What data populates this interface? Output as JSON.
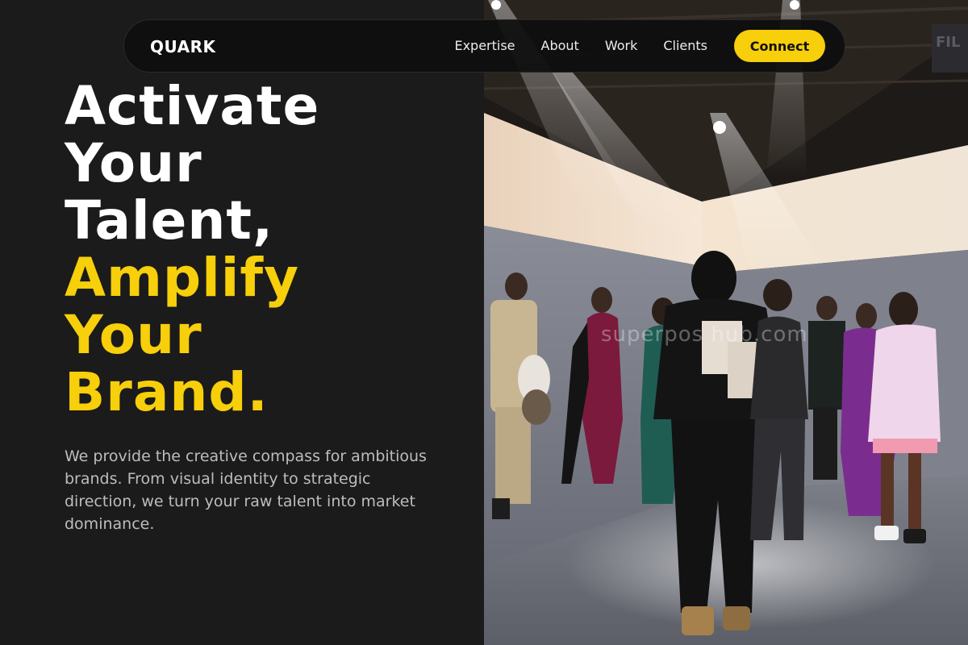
{
  "nav": {
    "logo": "QUARK",
    "links": [
      "Expertise",
      "About",
      "Work",
      "Clients"
    ],
    "cta": "Connect"
  },
  "hero": {
    "title_lines": [
      "Activate",
      "Your",
      "Talent,"
    ],
    "accent_lines": [
      "Amplify",
      "Your",
      "Brand."
    ],
    "description": "We provide the creative compass for ambitious brands. From visual identity to strategic direction, we turn your raw talent into market dominance."
  },
  "image": {
    "alt": "Fashion models posing in a dim industrial showroom under spotlights",
    "watermark": "superpos hub.com"
  },
  "colors": {
    "background": "#1b1b1b",
    "accent": "#f7cf0a",
    "text": "#ffffff",
    "muted_text": "#bdbdbd"
  }
}
